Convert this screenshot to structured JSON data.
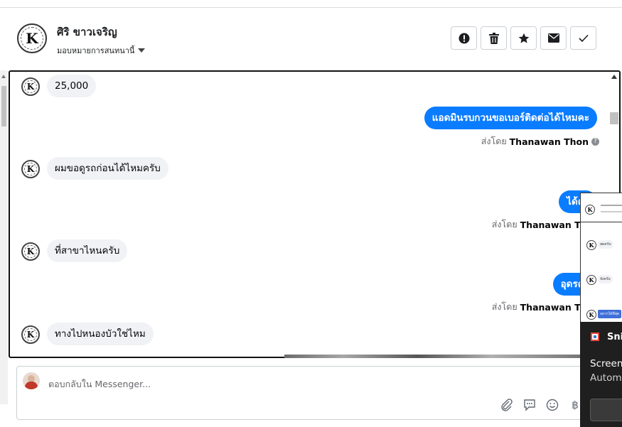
{
  "header": {
    "name": "ศิริ ขาวเจริญ",
    "assign_label": "มอบหมายการสนทนานี้",
    "actions": [
      {
        "name": "report-button",
        "icon": "alert-icon"
      },
      {
        "name": "delete-button",
        "icon": "trash-icon"
      },
      {
        "name": "star-button",
        "icon": "star-icon"
      },
      {
        "name": "mark-unread-button",
        "icon": "envelope-icon"
      },
      {
        "name": "mark-done-button",
        "icon": "check-icon"
      }
    ]
  },
  "messages": {
    "m1": "25,000",
    "m2": "แอดมินรบกวนขอเบอร์ติดต่อได้ไหมคะ",
    "m3": "ผมขอดูรถก่อนได้ไหมครับ",
    "m4": "ได้ค่ะ",
    "m5": "ที่สาขาไหนครับ",
    "m6": "อุดรค่ะ",
    "m7": "ทางไปหนองบัวใช่ไหม"
  },
  "sent_by": {
    "prefix": "ส่งโดย",
    "sender": "Thanawan Thon"
  },
  "reply": {
    "placeholder": "ตอบกลับใน Messenger..."
  },
  "toast": {
    "app": "Snip",
    "line1": "Screens",
    "line2": "Automa"
  },
  "mini_preview": {
    "b1": "สดครับ",
    "b2": "จังครับ",
    "b3": "อยากได้ที่สุด"
  },
  "colors": {
    "outgoing_bubble": "#0a7cff",
    "incoming_bubble": "#f0f2f5"
  },
  "currency_symbol": "฿"
}
